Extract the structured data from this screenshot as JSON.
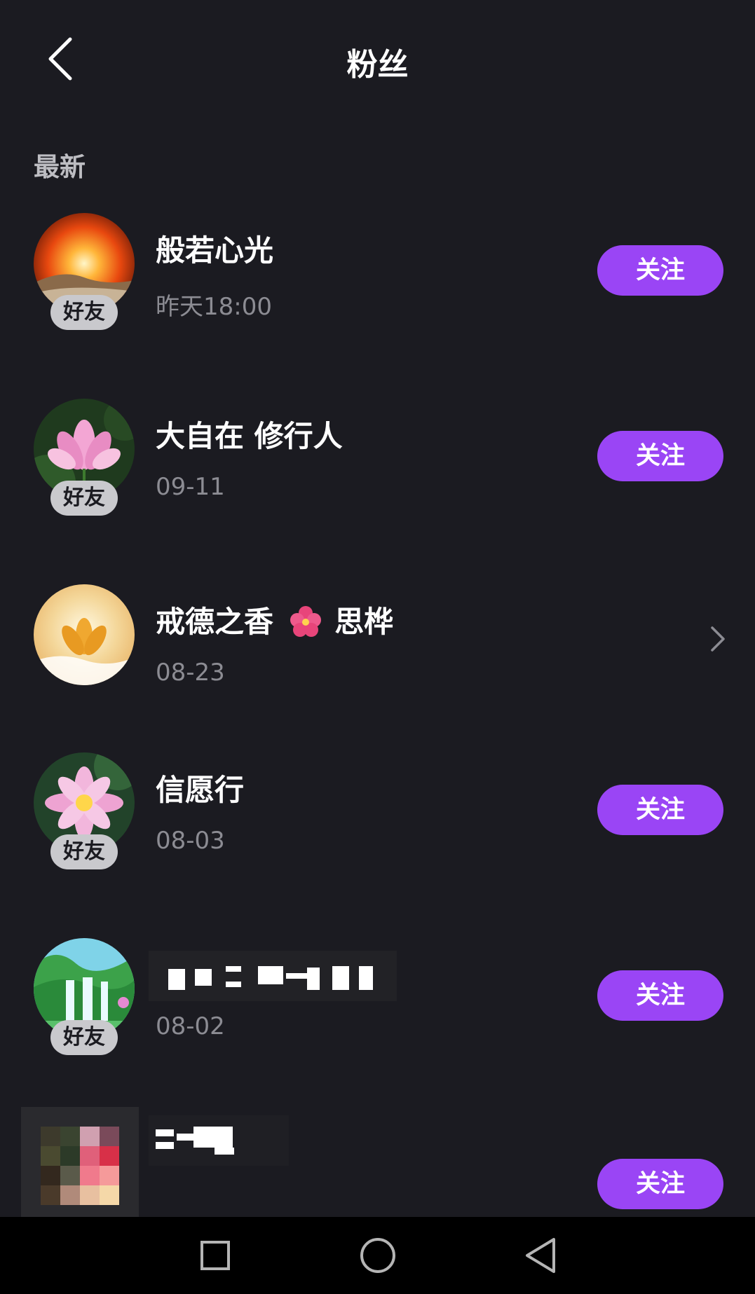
{
  "header": {
    "title": "粉丝"
  },
  "section": {
    "label": "最新"
  },
  "labels": {
    "friend_badge": "好友",
    "follow_button": "关注"
  },
  "fans": [
    {
      "name": "般若心光",
      "date": "昨天18:00",
      "is_friend": true,
      "action": "follow"
    },
    {
      "name": "大自在 修行人",
      "date": "09-11",
      "is_friend": true,
      "action": "follow"
    },
    {
      "name": "戒德之香",
      "name_suffix": "思桦",
      "date": "08-23",
      "is_friend": false,
      "action": "chevron"
    },
    {
      "name": "信愿行",
      "date": "08-03",
      "is_friend": true,
      "action": "follow"
    },
    {
      "name": "",
      "date": "08-02",
      "is_friend": true,
      "action": "follow"
    },
    {
      "name": "",
      "date": "",
      "is_friend": false,
      "action": "follow"
    }
  ],
  "colors": {
    "background": "#1b1b21",
    "accent": "#9a45f5",
    "badge": "#c9c9cd",
    "secondary_text": "#8c8c93"
  },
  "icons": {
    "back": "chevron-left-icon",
    "more": "chevron-right-icon",
    "nav": [
      "square-icon",
      "circle-icon",
      "triangle-back-icon"
    ]
  }
}
